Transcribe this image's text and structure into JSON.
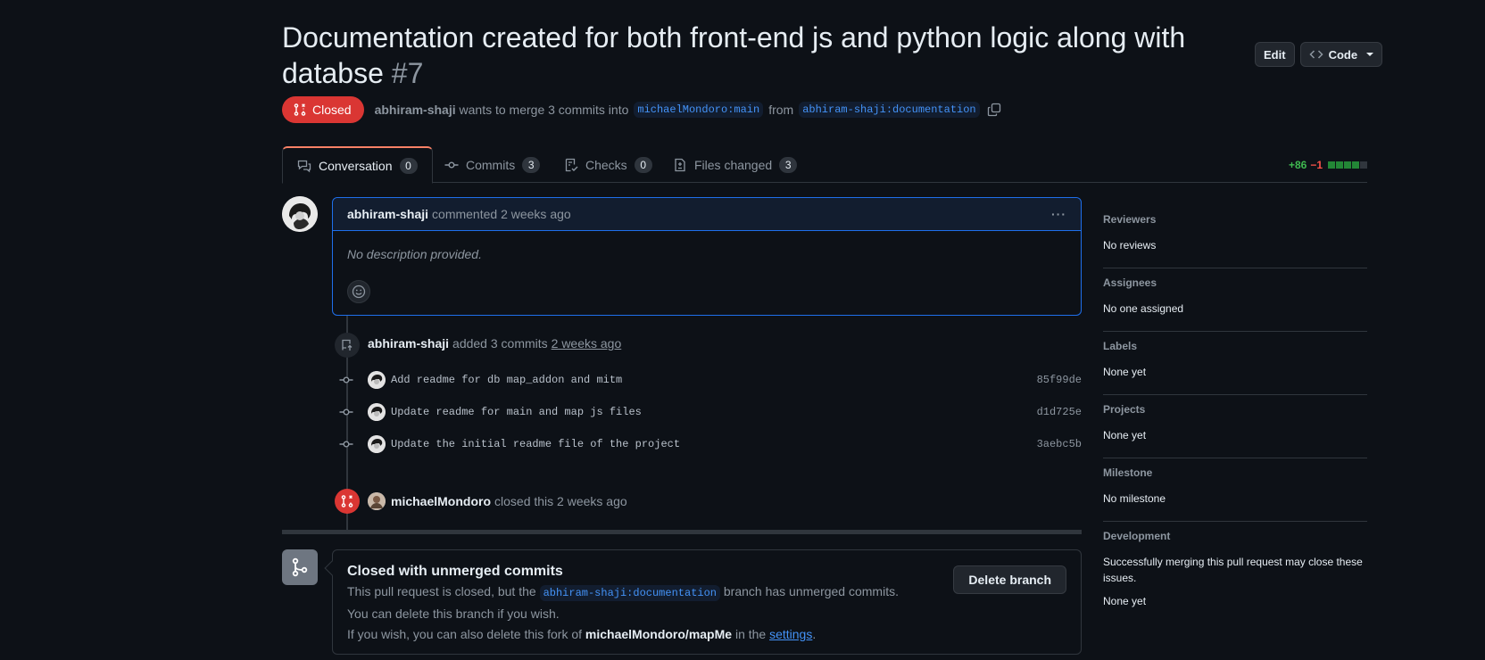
{
  "header": {
    "title": "Documentation created for both front-end js and python logic along with databse",
    "number": "#7",
    "edit_label": "Edit",
    "code_label": "Code"
  },
  "meta": {
    "state": "Closed",
    "author": "abhiram-shaji",
    "merge_text": "wants to merge 3 commits into",
    "base_branch": "michaelMondoro:main",
    "from_text": "from",
    "head_branch": "abhiram-shaji:documentation"
  },
  "tabs": [
    {
      "label": "Conversation",
      "count": "0"
    },
    {
      "label": "Commits",
      "count": "3"
    },
    {
      "label": "Checks",
      "count": "0"
    },
    {
      "label": "Files changed",
      "count": "3"
    }
  ],
  "diffstat": {
    "additions": "+86",
    "deletions": "−1"
  },
  "comment": {
    "author": "abhiram-shaji",
    "action": "commented 2 weeks ago",
    "body": "No description provided."
  },
  "commits_event": {
    "author": "abhiram-shaji",
    "text": "added 3 commits",
    "time": "2 weeks ago"
  },
  "commits": [
    {
      "message": "Add readme for db map_addon and mitm",
      "sha": "85f99de"
    },
    {
      "message": "Update readme for main and map js files",
      "sha": "d1d725e"
    },
    {
      "message": "Update the initial readme file of the project",
      "sha": "3aebc5b"
    }
  ],
  "closed_event": {
    "author": "michaelMondoro",
    "text": "closed this 2 weeks ago"
  },
  "merge_box": {
    "title": "Closed with unmerged commits",
    "line1_pre": "This pull request is closed, but the",
    "branch": "abhiram-shaji:documentation",
    "line1_post": "branch has unmerged commits. You can delete this branch if you wish.",
    "line2_pre": "If you wish, you can also delete this fork of",
    "repo": "michaelMondoro/mapMe",
    "line2_mid": "in the",
    "settings_link": "settings",
    "line2_end": ".",
    "delete_label": "Delete branch"
  },
  "sidebar": [
    {
      "heading": "Reviewers",
      "value": "No reviews"
    },
    {
      "heading": "Assignees",
      "value": "No one assigned"
    },
    {
      "heading": "Labels",
      "value": "None yet"
    },
    {
      "heading": "Projects",
      "value": "None yet"
    },
    {
      "heading": "Milestone",
      "value": "No milestone"
    },
    {
      "heading": "Development",
      "value": "Successfully merging this pull request may close these issues.",
      "value2": "None yet"
    }
  ],
  "colors": {
    "background": "#0d1117",
    "closed_red": "#da3633",
    "link_blue": "#4493f8",
    "additions_green": "#3fb950",
    "deletions_red": "#f85149"
  }
}
